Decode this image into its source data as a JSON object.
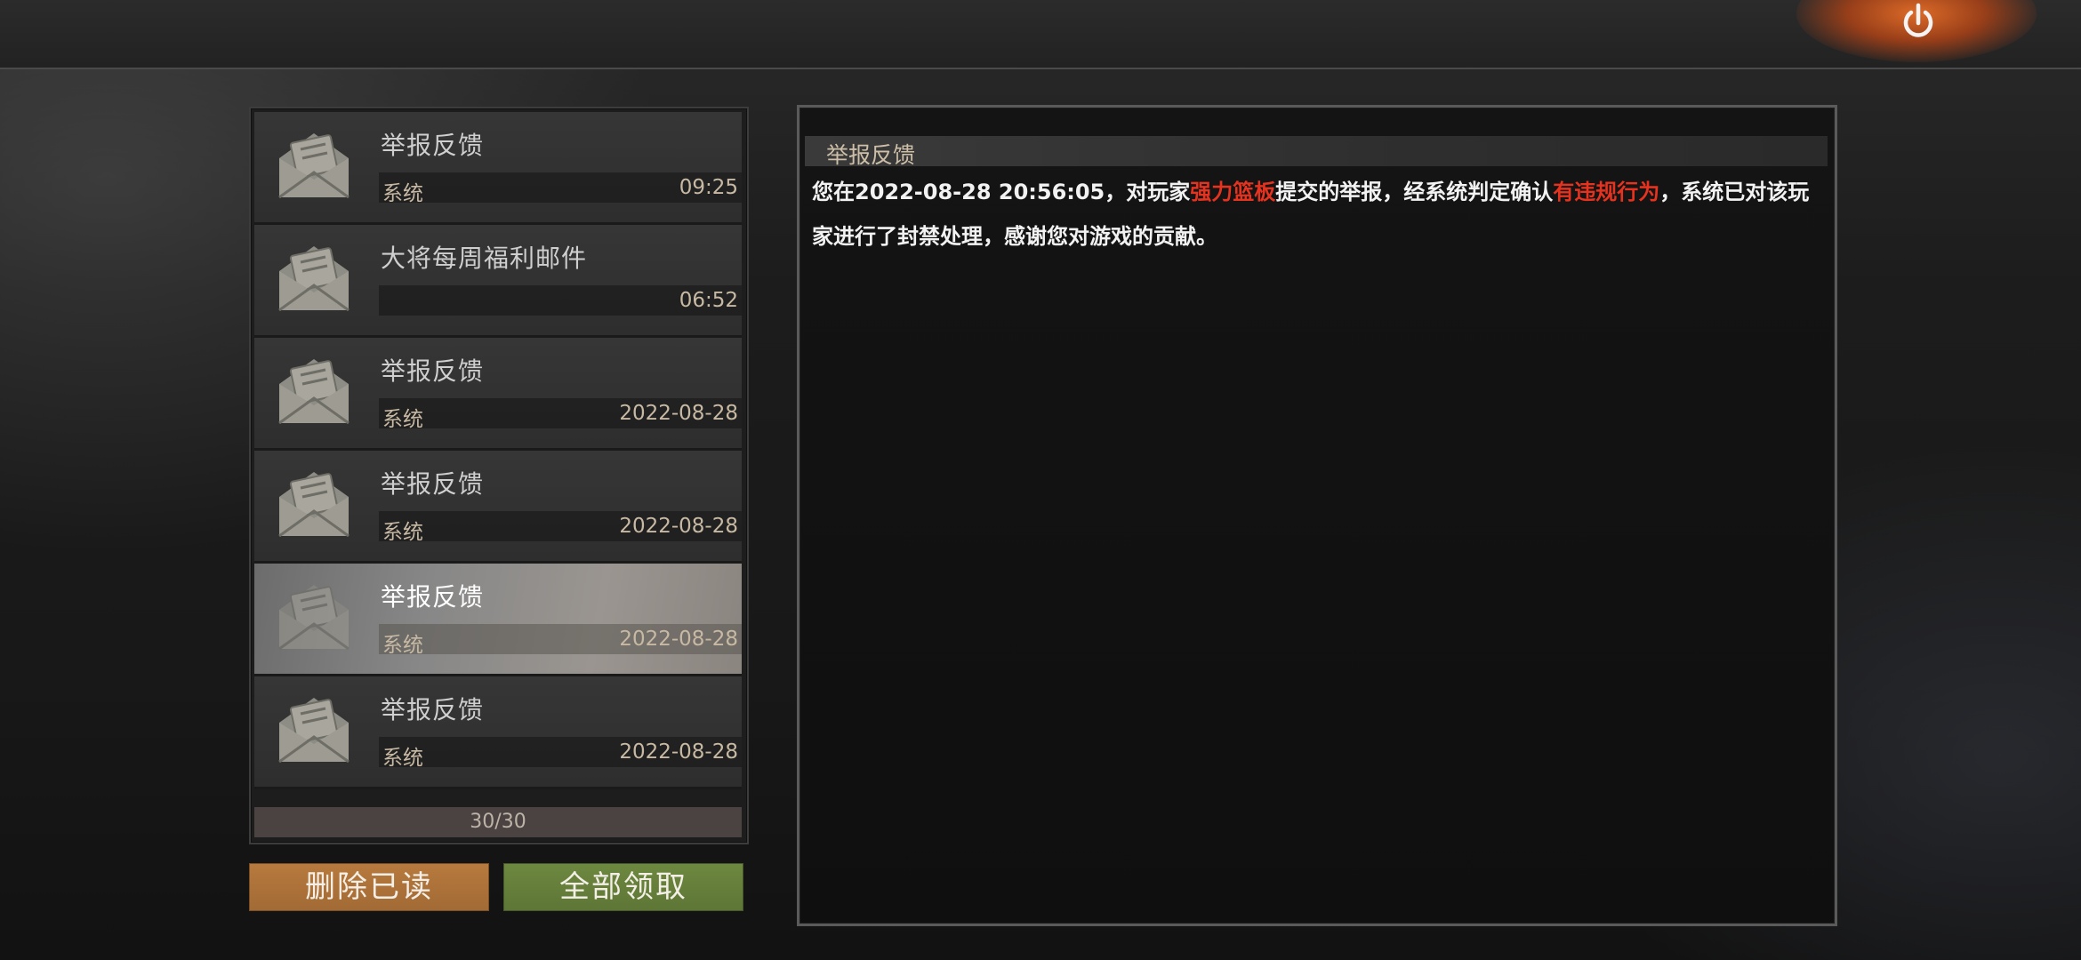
{
  "header": {
    "power_icon": "power-icon"
  },
  "mail_list": {
    "items": [
      {
        "title": "举报反馈",
        "sender": "系统",
        "time": "09:25",
        "icon": "envelope-open-icon"
      },
      {
        "title": "大将每周福利邮件",
        "sender": "",
        "time": "06:52",
        "icon": "envelope-open-icon"
      },
      {
        "title": "举报反馈",
        "sender": "系统",
        "time": "2022-08-28",
        "icon": "envelope-open-icon"
      },
      {
        "title": "举报反馈",
        "sender": "系统",
        "time": "2022-08-28",
        "icon": "envelope-open-icon"
      },
      {
        "title": "举报反馈",
        "sender": "系统",
        "time": "2022-08-28",
        "icon": "envelope-open-icon",
        "selected": true
      },
      {
        "title": "举报反馈",
        "sender": "系统",
        "time": "2022-08-28",
        "icon": "envelope-open-icon"
      }
    ],
    "count": "30/30"
  },
  "actions": {
    "delete_read": "删除已读",
    "claim_all": "全部领取"
  },
  "detail": {
    "title": "举报反馈",
    "body": {
      "part1": "您在2022-08-28 20:56:05，对玩家",
      "player": "强力篮板",
      "part2": "提交的举报，经系统判定确认",
      "verdict": "有违规行为",
      "part3": "，系统已对该玩家进行了封禁处理，感谢您对游戏的贡献。"
    }
  },
  "colors": {
    "highlight": "#e5331f",
    "delete_button": "#b77a3e",
    "claim_button": "#6d8840",
    "selected_item": "#878787"
  }
}
